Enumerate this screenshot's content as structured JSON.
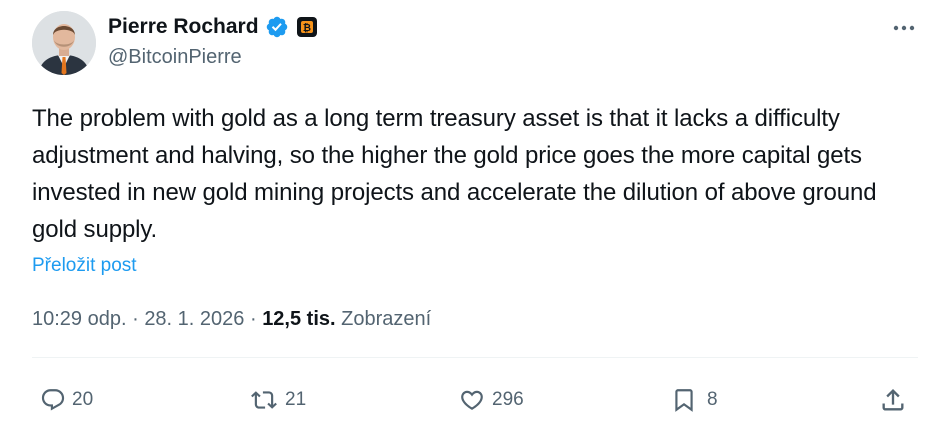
{
  "author": {
    "display_name": "Pierre Rochard",
    "handle": "@BitcoinPierre",
    "verified": true,
    "affiliation_badge": "bitcoin-icon"
  },
  "post": {
    "text": "The problem with gold as a long term treasury asset is that it lacks a difficulty adjustment and halving, so the higher the gold price goes the more capital gets invested in new gold mining projects and accelerate the dilution of above ground gold supply.",
    "translate_label": "Přeložit post"
  },
  "meta": {
    "time": "10:29 odp.",
    "separator": " · ",
    "date": "28. 1. 2026",
    "views_count": "12,5 tis.",
    "views_label": "Zobrazení"
  },
  "actions": {
    "replies": "20",
    "reposts": "21",
    "likes": "296",
    "bookmarks": "8"
  },
  "colors": {
    "accent": "#1d9bf0",
    "text": "#0f1419",
    "secondary": "#536471",
    "divider": "#eff3f4"
  }
}
